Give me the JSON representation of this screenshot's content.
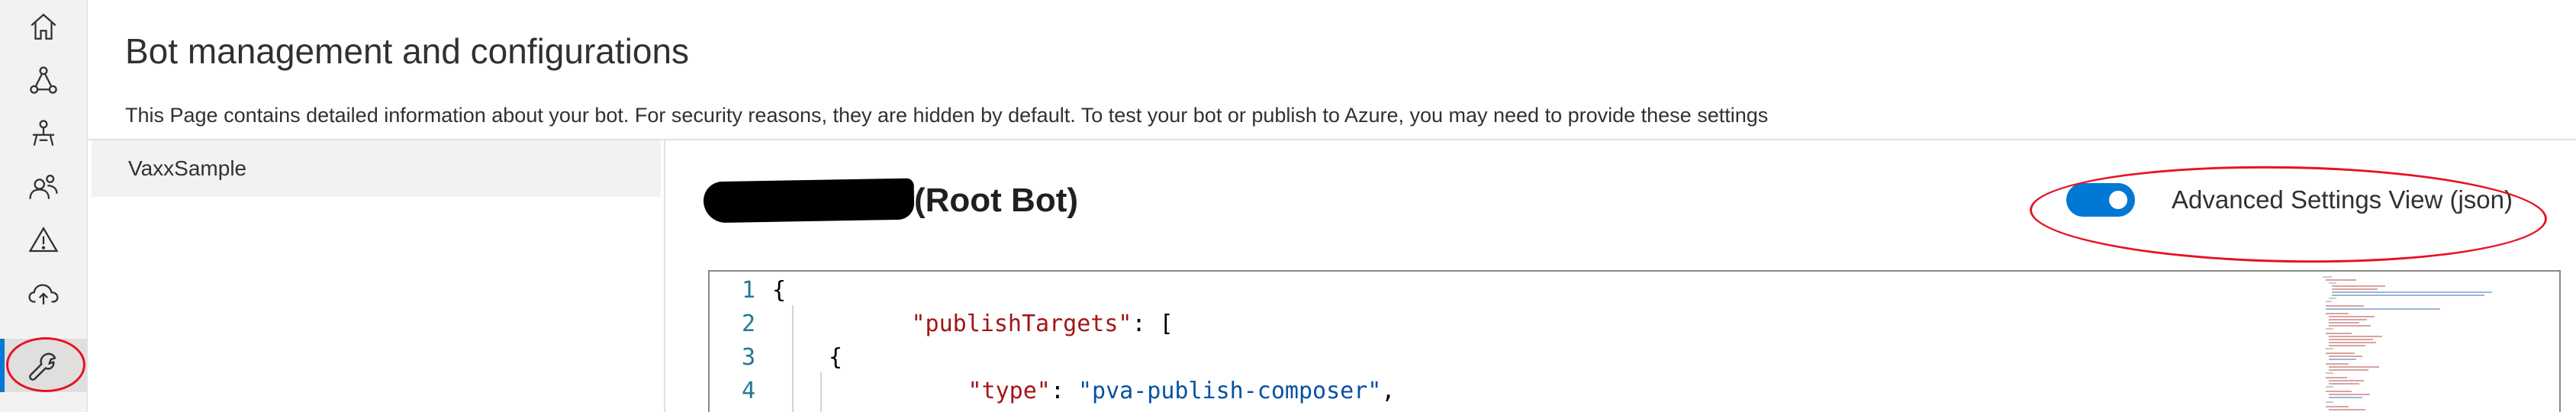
{
  "nav": {
    "items": [
      {
        "name": "home-icon"
      },
      {
        "name": "bot-design-icon"
      },
      {
        "name": "test-icon"
      },
      {
        "name": "users-icon"
      },
      {
        "name": "warning-icon"
      },
      {
        "name": "cloud-upload-icon"
      },
      {
        "name": "wrench-icon",
        "active": true
      }
    ]
  },
  "header": {
    "title": "Bot management and configurations",
    "description": "This Page contains detailed information about your bot. For security reasons, they are hidden by default. To test your bot or publish to Azure, you may need to provide these settings"
  },
  "bots": [
    {
      "label": "VaxxSample"
    }
  ],
  "bot_panel": {
    "name_suffix": "(Root Bot)",
    "toggle": {
      "label": "Advanced Settings View (json)",
      "on": true
    }
  },
  "editor": {
    "lines": [
      {
        "num": "1",
        "key": "",
        "text": "{"
      },
      {
        "num": "2",
        "key": "\"publishTargets\"",
        "text": ": ["
      },
      {
        "num": "3",
        "key": "",
        "text": "{"
      },
      {
        "num": "4",
        "key": "\"type\"",
        "text": ": ",
        "value": "\"pva-publish-composer\"",
        "tail": ","
      }
    ]
  },
  "colors": {
    "accent": "#0078d4",
    "annotation": "#e81123"
  }
}
